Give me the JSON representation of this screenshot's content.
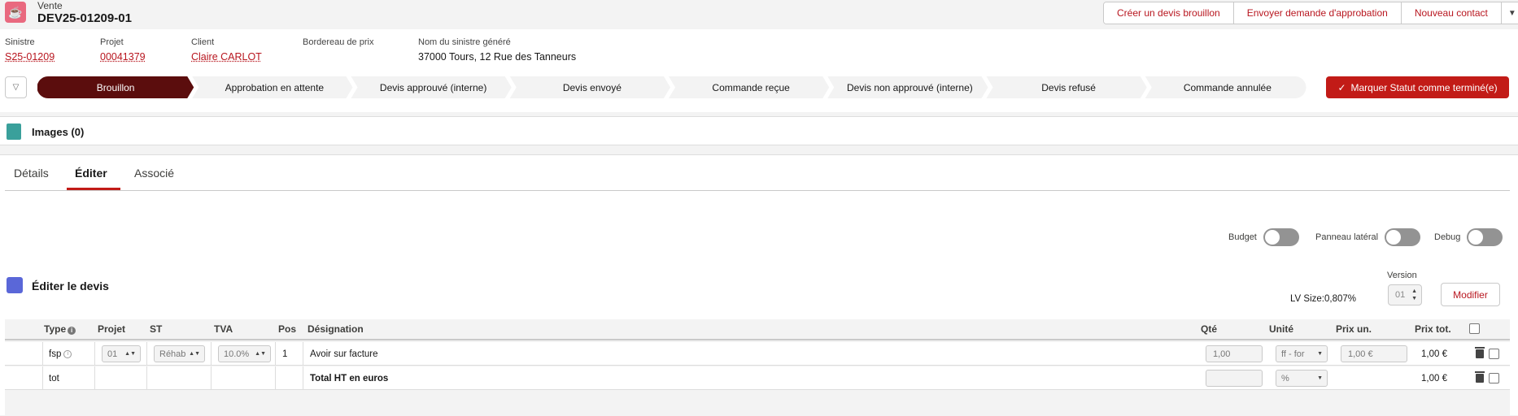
{
  "header": {
    "object_label": "Vente",
    "title": "DEV25-01209-01",
    "actions": [
      "Créer un devis brouillon",
      "Envoyer demande d'approbation",
      "Nouveau contact"
    ]
  },
  "highlights": [
    {
      "label": "Sinistre",
      "value": "S25-01209",
      "link": true
    },
    {
      "label": "Projet",
      "value": "00041379",
      "link": true
    },
    {
      "label": "Client",
      "value": "Claire CARLOT",
      "link": true
    },
    {
      "label": "Bordereau de prix",
      "value": "",
      "link": false
    },
    {
      "label": "Nom du sinistre généré",
      "value": "37000 Tours, 12 Rue des Tanneurs",
      "link": false
    }
  ],
  "path": {
    "stages": [
      "Brouillon",
      "Approbation en attente",
      "Devis approuvé (interne)",
      "Devis envoyé",
      "Commande reçue",
      "Devis non approuvé (interne)",
      "Devis refusé",
      "Commande annulée"
    ],
    "active_index": 0,
    "mark_complete_label": "Marquer Statut comme terminé(e)"
  },
  "images_card": {
    "title": "Images (0)"
  },
  "tabs": {
    "items": [
      "Détails",
      "Éditer",
      "Associé"
    ],
    "active": "Éditer"
  },
  "toggles": [
    {
      "label": "Budget",
      "on": false
    },
    {
      "label": "Panneau latéral",
      "on": false
    },
    {
      "label": "Debug",
      "on": false
    }
  ],
  "editor": {
    "title": "Éditer le devis",
    "lv_size": "LV Size:0,807%",
    "version_label": "Version",
    "version_value": "01",
    "modify_label": "Modifier"
  },
  "table": {
    "headers": {
      "type": "Type",
      "projet": "Projet",
      "st": "ST",
      "tva": "TVA",
      "pos": "Pos",
      "designation": "Désignation",
      "qte": "Qté",
      "unite": "Unité",
      "prix_un": "Prix un.",
      "prix_tot": "Prix tot."
    },
    "rows": [
      {
        "type": "fsp",
        "projet": "01",
        "st": "Réhab",
        "tva": "10.0%",
        "pos": "1",
        "designation": "Avoir sur facture",
        "qte": "1,00",
        "unite": "ff - for",
        "prix_un": "1,00 €",
        "prix_tot": "1,00 €"
      },
      {
        "type": "tot",
        "projet": "",
        "st": "",
        "tva": "",
        "pos": "",
        "designation": "Total HT en euros",
        "qte": "",
        "unite": "%",
        "prix_un": "",
        "prix_tot": "1,00 €"
      }
    ]
  },
  "colors": {
    "brand_red": "#c21b17",
    "active_stage": "#5b0d0d",
    "link_red": "#b8161f"
  }
}
